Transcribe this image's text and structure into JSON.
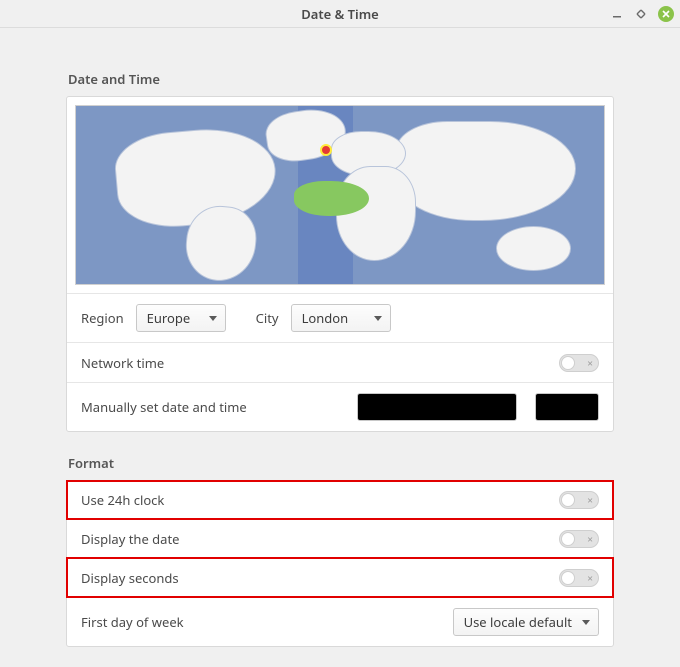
{
  "window": {
    "title": "Date & Time"
  },
  "sections": {
    "date_time": {
      "heading": "Date and Time",
      "region_label": "Region",
      "region_value": "Europe",
      "city_label": "City",
      "city_value": "London",
      "network_time_label": "Network time",
      "network_time_on": false,
      "manual_label": "Manually set date and time"
    },
    "format": {
      "heading": "Format",
      "use_24h_label": "Use 24h clock",
      "use_24h_on": false,
      "display_date_label": "Display the date",
      "display_date_on": false,
      "display_seconds_label": "Display seconds",
      "display_seconds_on": false,
      "first_day_label": "First day of week",
      "first_day_value": "Use locale default"
    }
  }
}
